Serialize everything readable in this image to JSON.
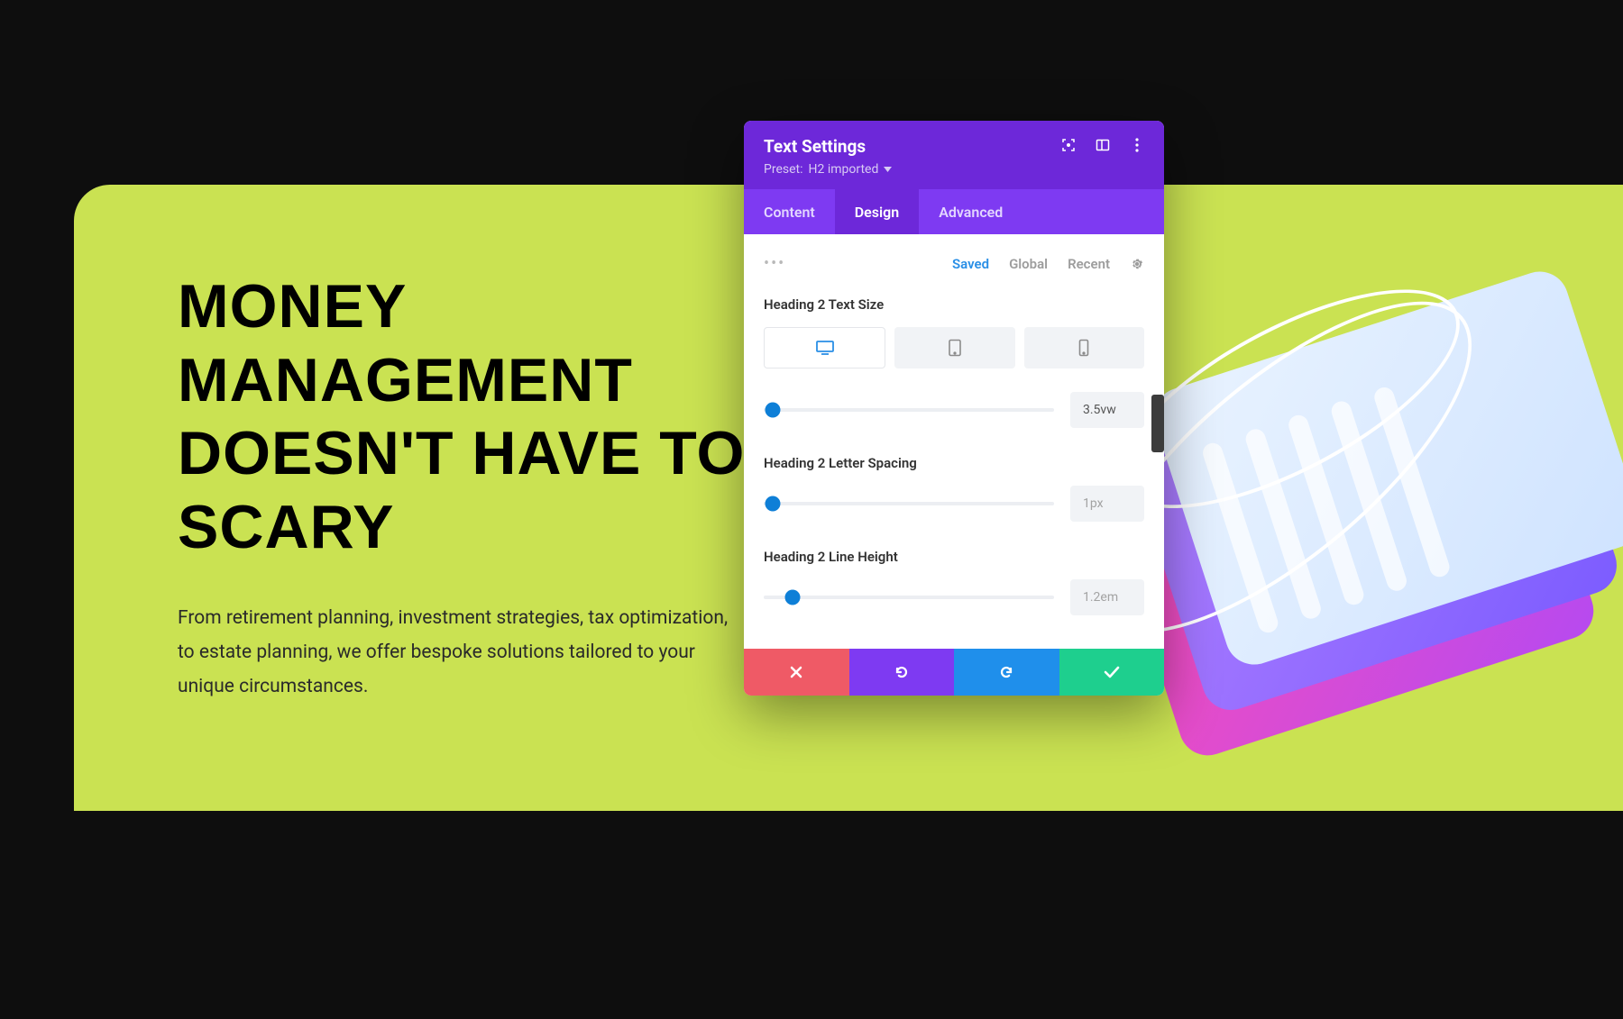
{
  "page": {
    "headline": "MONEY MANAGEMENT DOESN'T HAVE TO SCARY",
    "subtext": "From retirement planning, investment strategies, tax optimization, to estate planning, we offer bespoke solutions tailored to your unique circumstances."
  },
  "settings": {
    "title": "Text Settings",
    "preset_prefix": "Preset: ",
    "preset_name": "H2 imported",
    "tabs": {
      "content": "Content",
      "design": "Design",
      "advanced": "Advanced"
    },
    "filters": {
      "saved": "Saved",
      "global": "Global",
      "recent": "Recent"
    },
    "controls": {
      "text_size": {
        "label": "Heading 2 Text Size",
        "value": "3.5vw",
        "knob_percent": 3
      },
      "letter_spacing": {
        "label": "Heading 2 Letter Spacing",
        "value": "1px",
        "knob_percent": 3
      },
      "line_height": {
        "label": "Heading 2 Line Height",
        "value": "1.2em",
        "knob_percent": 10
      }
    }
  },
  "colors": {
    "accent_purple": "#6d28d9",
    "accent_purple_light": "#7e3af2",
    "accent_blue": "#2a8fe6",
    "green_bg": "#cae252"
  }
}
